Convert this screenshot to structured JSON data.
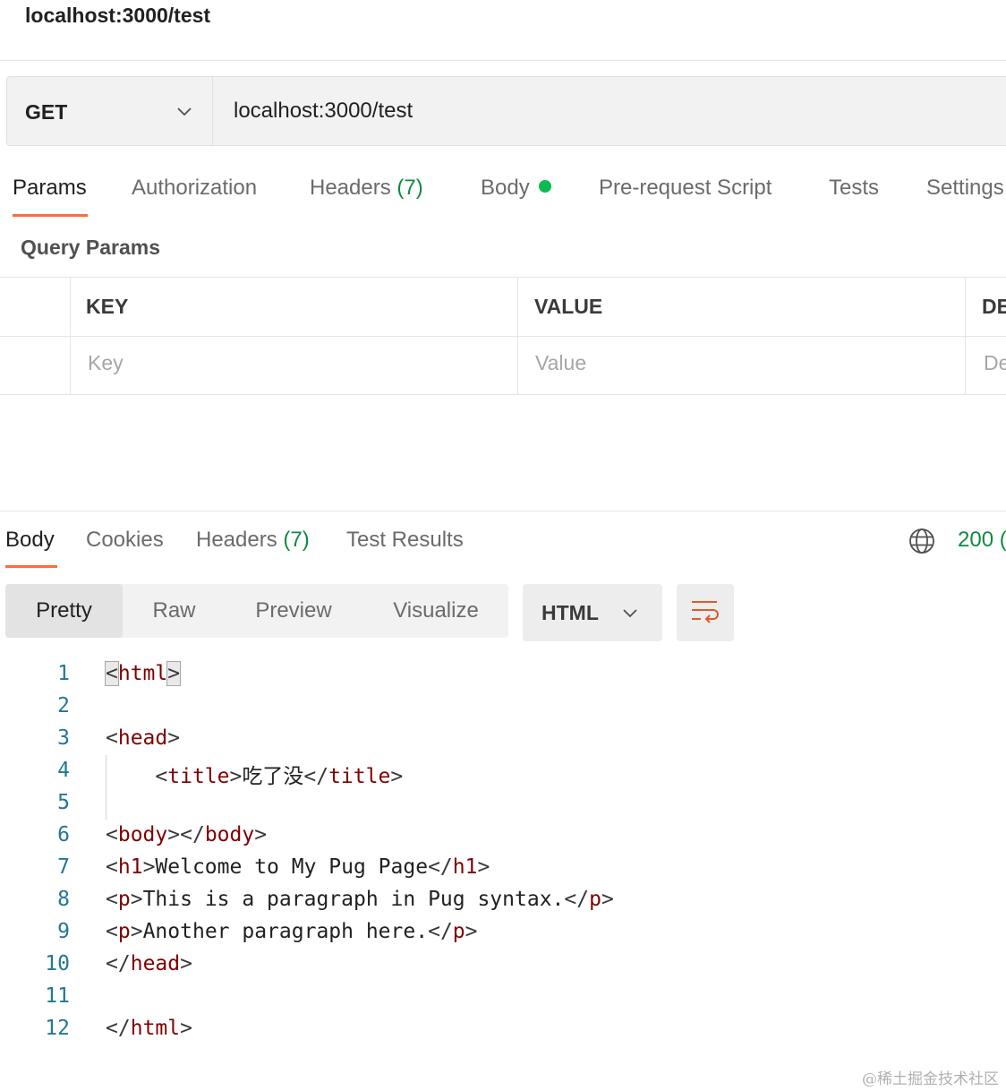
{
  "window": {
    "title": "localhost:3000/test"
  },
  "request": {
    "method": "GET",
    "url": "localhost:3000/test"
  },
  "request_tabs": [
    {
      "label": "Params",
      "active": true
    },
    {
      "label": "Authorization"
    },
    {
      "label": "Headers",
      "count": "(7)"
    },
    {
      "label": "Body",
      "indicator": "green-dot"
    },
    {
      "label": "Pre-request Script"
    },
    {
      "label": "Tests"
    },
    {
      "label": "Settings"
    }
  ],
  "query_params": {
    "title": "Query Params",
    "columns": [
      "KEY",
      "VALUE",
      "DE"
    ],
    "placeholders": [
      "Key",
      "Value",
      "De"
    ]
  },
  "response_tabs": [
    {
      "label": "Body",
      "active": true
    },
    {
      "label": "Cookies"
    },
    {
      "label": "Headers",
      "count": "(7)"
    },
    {
      "label": "Test Results"
    }
  ],
  "response_status": "200 (",
  "view_modes": [
    {
      "label": "Pretty",
      "active": true
    },
    {
      "label": "Raw"
    },
    {
      "label": "Preview"
    },
    {
      "label": "Visualize"
    }
  ],
  "format": "HTML",
  "code_lines": [
    {
      "n": "1",
      "text": "<html>"
    },
    {
      "n": "2",
      "text": ""
    },
    {
      "n": "3",
      "text": "<head>"
    },
    {
      "n": "4",
      "text": "    <title>吃了没</title>"
    },
    {
      "n": "5",
      "text": ""
    },
    {
      "n": "6",
      "text": "<body></body>"
    },
    {
      "n": "7",
      "text": "<h1>Welcome to My Pug Page</h1>"
    },
    {
      "n": "8",
      "text": "<p>This is a paragraph in Pug syntax.</p>"
    },
    {
      "n": "9",
      "text": "<p>Another paragraph here.</p>"
    },
    {
      "n": "10",
      "text": "</head>"
    },
    {
      "n": "11",
      "text": ""
    },
    {
      "n": "12",
      "text": "</html>"
    }
  ],
  "watermark": "@稀土掘金技术社区",
  "colors": {
    "accent": "#ff6c37",
    "success": "#0f8a3f",
    "dot": "#0cbb52",
    "tag": "#800000",
    "line_number": "#237893"
  }
}
